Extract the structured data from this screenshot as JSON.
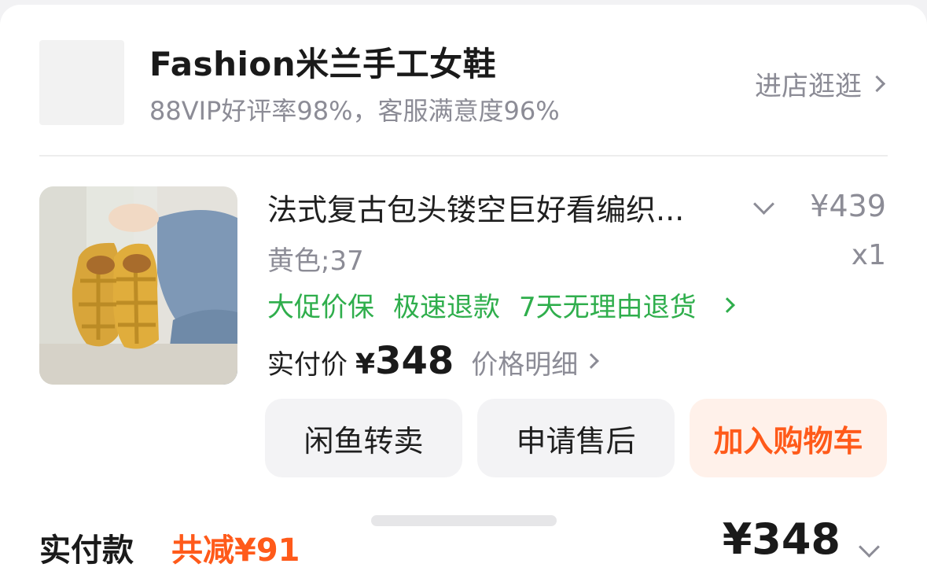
{
  "shop": {
    "name": "Fashion米兰手工女鞋",
    "rating": "88VIP好评率98%，客服满意度96%",
    "enter_label": "进店逛逛"
  },
  "product": {
    "title": "法式复古包头镂空巨好看编织...",
    "original_price": "¥439",
    "variant": "黄色;37",
    "quantity": "x1",
    "services": [
      "大促价保",
      "极速退款",
      "7天无理由退货"
    ],
    "paid_label": "实付价",
    "paid_currency": "¥",
    "paid_amount": "348",
    "price_detail_label": "价格明细"
  },
  "actions": {
    "resell_label": "闲鱼转卖",
    "after_sales_label": "申请售后",
    "add_to_cart_label": "加入购物车"
  },
  "summary": {
    "label": "实付款",
    "discount": "共减¥91",
    "total": "¥348"
  },
  "colors": {
    "accent_orange": "#ff5a1a",
    "service_green": "#2fae4c",
    "muted_text": "#8c8c96"
  },
  "icons": {
    "shop_enter": "chevron-right-icon",
    "expand": "chevron-down-icon",
    "services_more": "chevron-right-icon",
    "price_detail": "chevron-right-icon",
    "summary_expand": "chevron-down-icon"
  }
}
